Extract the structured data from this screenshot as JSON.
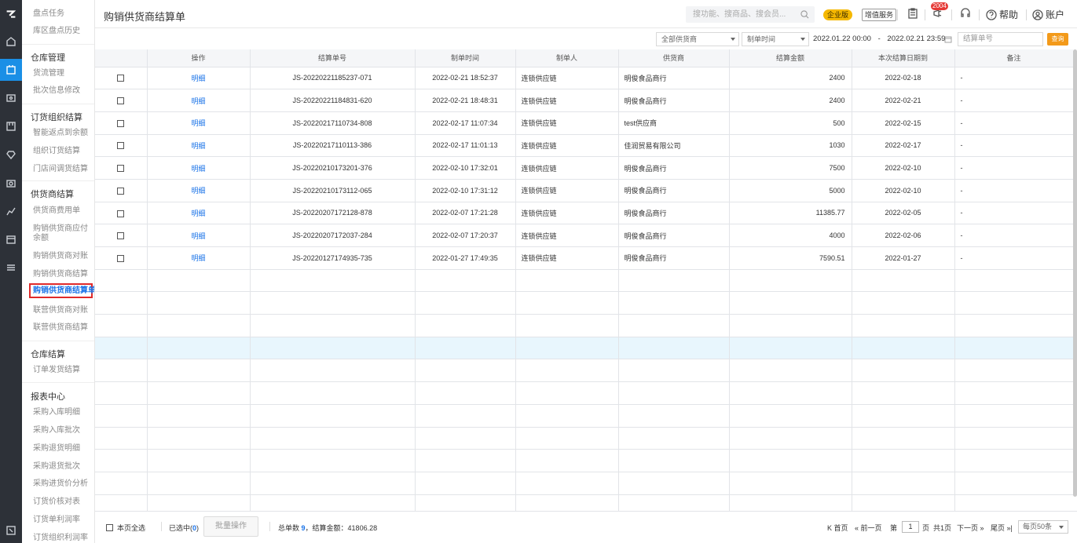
{
  "app": {
    "page_title": "购销供货商结算单"
  },
  "header": {
    "search_placeholder": "搜功能、搜商品、搜会员...",
    "enterprise_badge": "企业版",
    "value_added": "增值服务",
    "notification_count": "2004",
    "help": "帮助",
    "account": "账户"
  },
  "sidebar": {
    "top_items": [
      "盘点任务",
      "库区盘点历史"
    ],
    "sections": [
      {
        "title": "仓库管理",
        "items": [
          "货流管理",
          "批次信息修改"
        ]
      },
      {
        "title": "订货组织结算",
        "items": [
          "智能返点到余额",
          "组织订货结算",
          "门店间调货结算"
        ]
      },
      {
        "title": "供货商结算",
        "items": [
          "供货商费用单",
          "购销供货商应付余额",
          "购销供货商对账",
          "购销供货商结算",
          "购销供货商结算单",
          "联营供货商对账",
          "联营供货商结算"
        ]
      },
      {
        "title": "仓库结算",
        "items": [
          "订单发货结算"
        ]
      },
      {
        "title": "报表中心",
        "items": [
          "采购入库明细",
          "采购入库批次",
          "采购退货明细",
          "采购退货批次",
          "采购进货价分析",
          "订货价核对表",
          "订货单利润率",
          "订货组织利润率"
        ]
      }
    ],
    "current_item": "购销供货商结算单"
  },
  "filters": {
    "supplier_select": "全部供货商",
    "time_type_select": "制单时间",
    "date_start": "2022.01.22 00:00",
    "date_sep": "-",
    "date_end": "2022.02.21 23:59",
    "settlement_no_placeholder": "结算单号",
    "query_button": "查询"
  },
  "table": {
    "columns": [
      "",
      "操作",
      "结算单号",
      "制单时间",
      "制单人",
      "供货商",
      "结算金额",
      "本次结算日期到",
      "备注"
    ],
    "rows": [
      {
        "op": "明细",
        "no": "JS-20220221185237-071",
        "time": "2022-02-21 18:52:37",
        "creator": "连锁供应链",
        "supplier": "明俊食品商行",
        "amount": "2400",
        "end_date": "2022-02-18",
        "remark": "-"
      },
      {
        "op": "明细",
        "no": "JS-20220221184831-620",
        "time": "2022-02-21 18:48:31",
        "creator": "连锁供应链",
        "supplier": "明俊食品商行",
        "amount": "2400",
        "end_date": "2022-02-21",
        "remark": "-"
      },
      {
        "op": "明细",
        "no": "JS-20220217110734-808",
        "time": "2022-02-17 11:07:34",
        "creator": "连锁供应链",
        "supplier": "test供应商",
        "amount": "500",
        "end_date": "2022-02-15",
        "remark": "-"
      },
      {
        "op": "明细",
        "no": "JS-20220217110113-386",
        "time": "2022-02-17 11:01:13",
        "creator": "连锁供应链",
        "supplier": "佳润贸易有限公司",
        "amount": "1030",
        "end_date": "2022-02-17",
        "remark": "-"
      },
      {
        "op": "明细",
        "no": "JS-20220210173201-376",
        "time": "2022-02-10 17:32:01",
        "creator": "连锁供应链",
        "supplier": "明俊食品商行",
        "amount": "7500",
        "end_date": "2022-02-10",
        "remark": "-"
      },
      {
        "op": "明细",
        "no": "JS-20220210173112-065",
        "time": "2022-02-10 17:31:12",
        "creator": "连锁供应链",
        "supplier": "明俊食品商行",
        "amount": "5000",
        "end_date": "2022-02-10",
        "remark": "-"
      },
      {
        "op": "明细",
        "no": "JS-20220207172128-878",
        "time": "2022-02-07 17:21:28",
        "creator": "连锁供应链",
        "supplier": "明俊食品商行",
        "amount": "11385.77",
        "end_date": "2022-02-05",
        "remark": "-"
      },
      {
        "op": "明细",
        "no": "JS-20220207172037-284",
        "time": "2022-02-07 17:20:37",
        "creator": "连锁供应链",
        "supplier": "明俊食品商行",
        "amount": "4000",
        "end_date": "2022-02-06",
        "remark": "-"
      },
      {
        "op": "明细",
        "no": "JS-20220127174935-735",
        "time": "2022-01-27 17:49:35",
        "creator": "连锁供应链",
        "supplier": "明俊食品商行",
        "amount": "7590.51",
        "end_date": "2022-01-27",
        "remark": "-"
      }
    ]
  },
  "footer": {
    "select_all": "本页全选",
    "selected_label": "已选中(",
    "selected_count": "0",
    "selected_close": ")",
    "batch_button": "批量操作",
    "total_label": "总单数",
    "total_count": "9",
    "amount_label": "，结算金额：41806.28",
    "first_page": "K 首页",
    "prev_page": "« 前一页",
    "page_prefix": "第",
    "page_value": "1",
    "page_suffix": "页",
    "total_pages": "共1页",
    "next_page": "下一页 »",
    "last_page": "尾页 »|",
    "page_size": "每页50条"
  }
}
